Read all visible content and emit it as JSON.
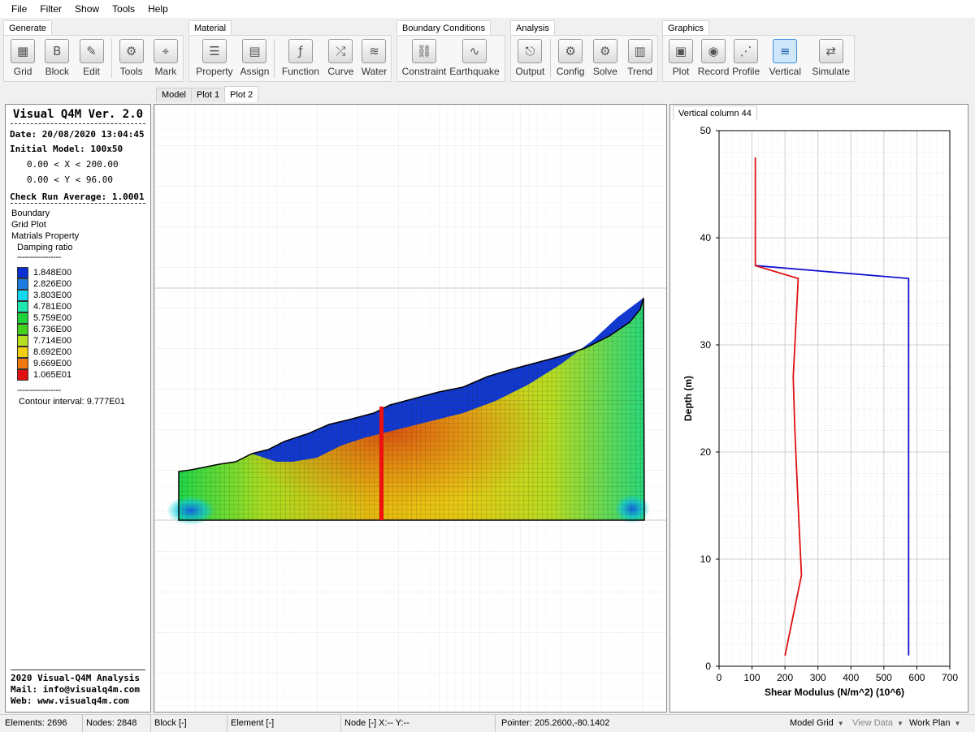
{
  "menu": [
    "File",
    "Filter",
    "Show",
    "Tools",
    "Help"
  ],
  "ribbon": {
    "groups": [
      {
        "name": "Generate",
        "buttons": [
          {
            "label": "Grid",
            "icon": "grid-icon",
            "glyph": "▦"
          },
          {
            "label": "Block",
            "icon": "block-icon",
            "glyph": "B"
          },
          {
            "label": "Edit",
            "icon": "edit-icon",
            "glyph": "✎"
          },
          {
            "label": "Tools",
            "icon": "gear-icon",
            "glyph": "⚙"
          },
          {
            "label": "Mark",
            "icon": "mark-icon",
            "glyph": "⌖"
          }
        ]
      },
      {
        "name": "Material",
        "buttons": [
          {
            "label": "Property",
            "icon": "property-icon",
            "glyph": "☰"
          },
          {
            "label": "Assign",
            "icon": "assign-icon",
            "glyph": "▤"
          },
          {
            "label": "Function",
            "icon": "function-icon",
            "glyph": "ƒ"
          },
          {
            "label": "Curve",
            "icon": "curve-icon",
            "glyph": "⤮"
          },
          {
            "label": "Water",
            "icon": "water-icon",
            "glyph": "≋"
          }
        ]
      },
      {
        "name": "Boundary Conditions",
        "buttons": [
          {
            "label": "Constraint",
            "icon": "constraint-icon",
            "glyph": "⛓"
          },
          {
            "label": "Earthquake",
            "icon": "earthquake-icon",
            "glyph": "∿"
          }
        ]
      },
      {
        "name": "Analysis",
        "buttons": [
          {
            "label": "Output",
            "icon": "output-icon",
            "glyph": "⎋"
          },
          {
            "label": "Config",
            "icon": "config-icon",
            "glyph": "⚙"
          },
          {
            "label": "Solve",
            "icon": "solve-icon",
            "glyph": "⚙"
          },
          {
            "label": "Trend",
            "icon": "trend-icon",
            "glyph": "▥"
          }
        ]
      },
      {
        "name": "Graphics",
        "buttons": [
          {
            "label": "Plot",
            "icon": "plot-icon",
            "glyph": "▣"
          },
          {
            "label": "Record",
            "icon": "record-icon",
            "glyph": "◉"
          },
          {
            "label": "Profile",
            "icon": "profile-icon",
            "glyph": "⋰"
          },
          {
            "label": "Vertical",
            "icon": "vertical-icon",
            "glyph": "≡",
            "active": true
          },
          {
            "label": "Simulate",
            "icon": "simulate-icon",
            "glyph": "⇄"
          }
        ]
      }
    ]
  },
  "doc_tabs": [
    "Model",
    "Plot 1",
    "Plot 2"
  ],
  "active_doc_tab": "Plot 2",
  "info": {
    "title": "Visual Q4M Ver. 2.0",
    "date": "Date: 20/08/2020 13:04:45",
    "initial_model": "Initial Model: 100x50",
    "x_range": "0.00 < X < 200.00",
    "y_range": "0.00 < Y < 96.00",
    "check_run": "Check Run Average: 1.0001",
    "items": [
      "Boundary",
      "Grid Plot",
      "Matrials Property"
    ],
    "subitem": "Damping ratio",
    "dash_line": "-----------------",
    "legend": [
      {
        "value": "1.848E00",
        "color": "#0a2fd0"
      },
      {
        "value": "2.826E00",
        "color": "#1b7be0"
      },
      {
        "value": "3.803E00",
        "color": "#10d8f0"
      },
      {
        "value": "4.781E00",
        "color": "#1ee8b0"
      },
      {
        "value": "5.759E00",
        "color": "#1fd43a"
      },
      {
        "value": "6.736E00",
        "color": "#44d21c"
      },
      {
        "value": "7.714E00",
        "color": "#b8e020"
      },
      {
        "value": "8.692E00",
        "color": "#f0d010"
      },
      {
        "value": "9.669E00",
        "color": "#f07a10"
      },
      {
        "value": "1.065E01",
        "color": "#e01010"
      }
    ],
    "contour_interval": "Contour interval: 9.777E01",
    "footer": [
      "2020 Visual-Q4M Analysis",
      "Mail: info@visualq4m.com",
      "Web: www.visualq4m.com"
    ]
  },
  "right_tab": "Vertical column 44",
  "chart_data": {
    "type": "line",
    "xlabel": "Shear Modulus (N/m^2) (10^6)",
    "ylabel": "Depth (m)",
    "xlim": [
      0,
      700
    ],
    "ylim": [
      0,
      50
    ],
    "xticks": [
      0,
      100,
      200,
      300,
      400,
      500,
      600,
      700
    ],
    "yticks": [
      0,
      10,
      20,
      30,
      40,
      50
    ],
    "grid": true,
    "series": [
      {
        "color": "#1010d0",
        "x": [
          575,
          575,
          110
        ],
        "y": [
          1,
          36.2,
          37.4
        ]
      },
      {
        "color": "#e01010",
        "x": [
          200,
          250,
          240,
          230,
          225,
          235,
          240,
          110,
          110
        ],
        "y": [
          1,
          8.5,
          15,
          22,
          27,
          33,
          36.2,
          37.4,
          47.5
        ]
      }
    ]
  },
  "status": {
    "elements": "Elements: 2696",
    "nodes": "Nodes: 2848",
    "block": "Block [-]",
    "element": "Element [-]",
    "node": "Node [-]  X:--  Y:--",
    "pointer": "Pointer: 205.2600,-80.1402",
    "model_grid": "Model Grid",
    "view_data": "View Data",
    "work_plan": "Work Plan"
  }
}
